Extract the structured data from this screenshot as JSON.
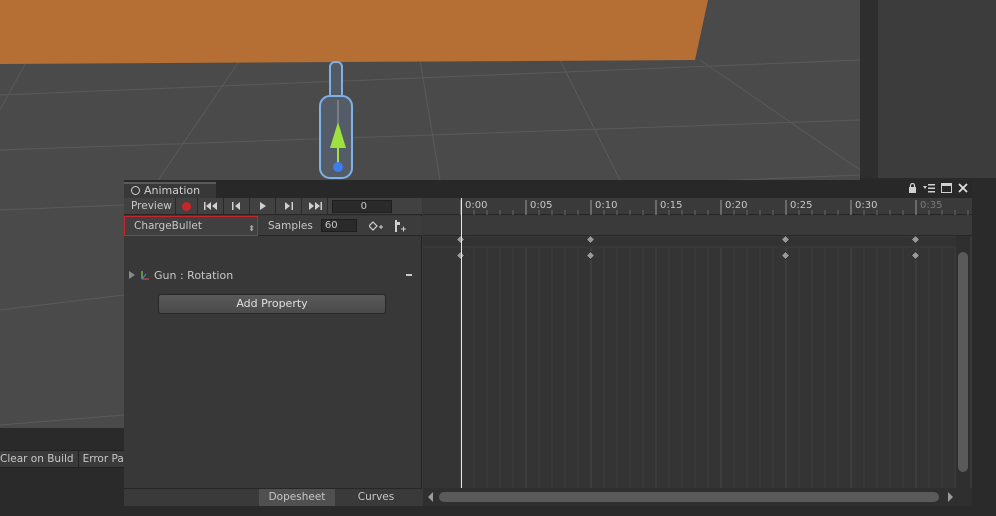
{
  "console": {
    "buttons": [
      "Clear on Build",
      "Error Pau"
    ]
  },
  "animation_window": {
    "tab_title": "Animation",
    "toolbar": {
      "preview_label": "Preview",
      "current_frame": "0"
    },
    "clip": {
      "name": "ChargeBullet",
      "samples_label": "Samples",
      "samples_value": "60"
    },
    "property": {
      "label": "Gun : Rotation"
    },
    "add_property_label": "Add Property",
    "bottom_tabs": {
      "dopesheet": "Dopesheet",
      "curves": "Curves"
    },
    "timeline": {
      "ticks": [
        "0:00",
        "0:05",
        "0:10",
        "0:15",
        "0:20",
        "0:25",
        "0:30",
        "0:35"
      ],
      "keyframe_times": [
        "0:00",
        "0:10",
        "0:25",
        "0:35"
      ]
    }
  },
  "colors": {
    "record": "#c8262a",
    "clip_selection_outline": "#c8262a",
    "scene_plane": "#b56f35"
  }
}
